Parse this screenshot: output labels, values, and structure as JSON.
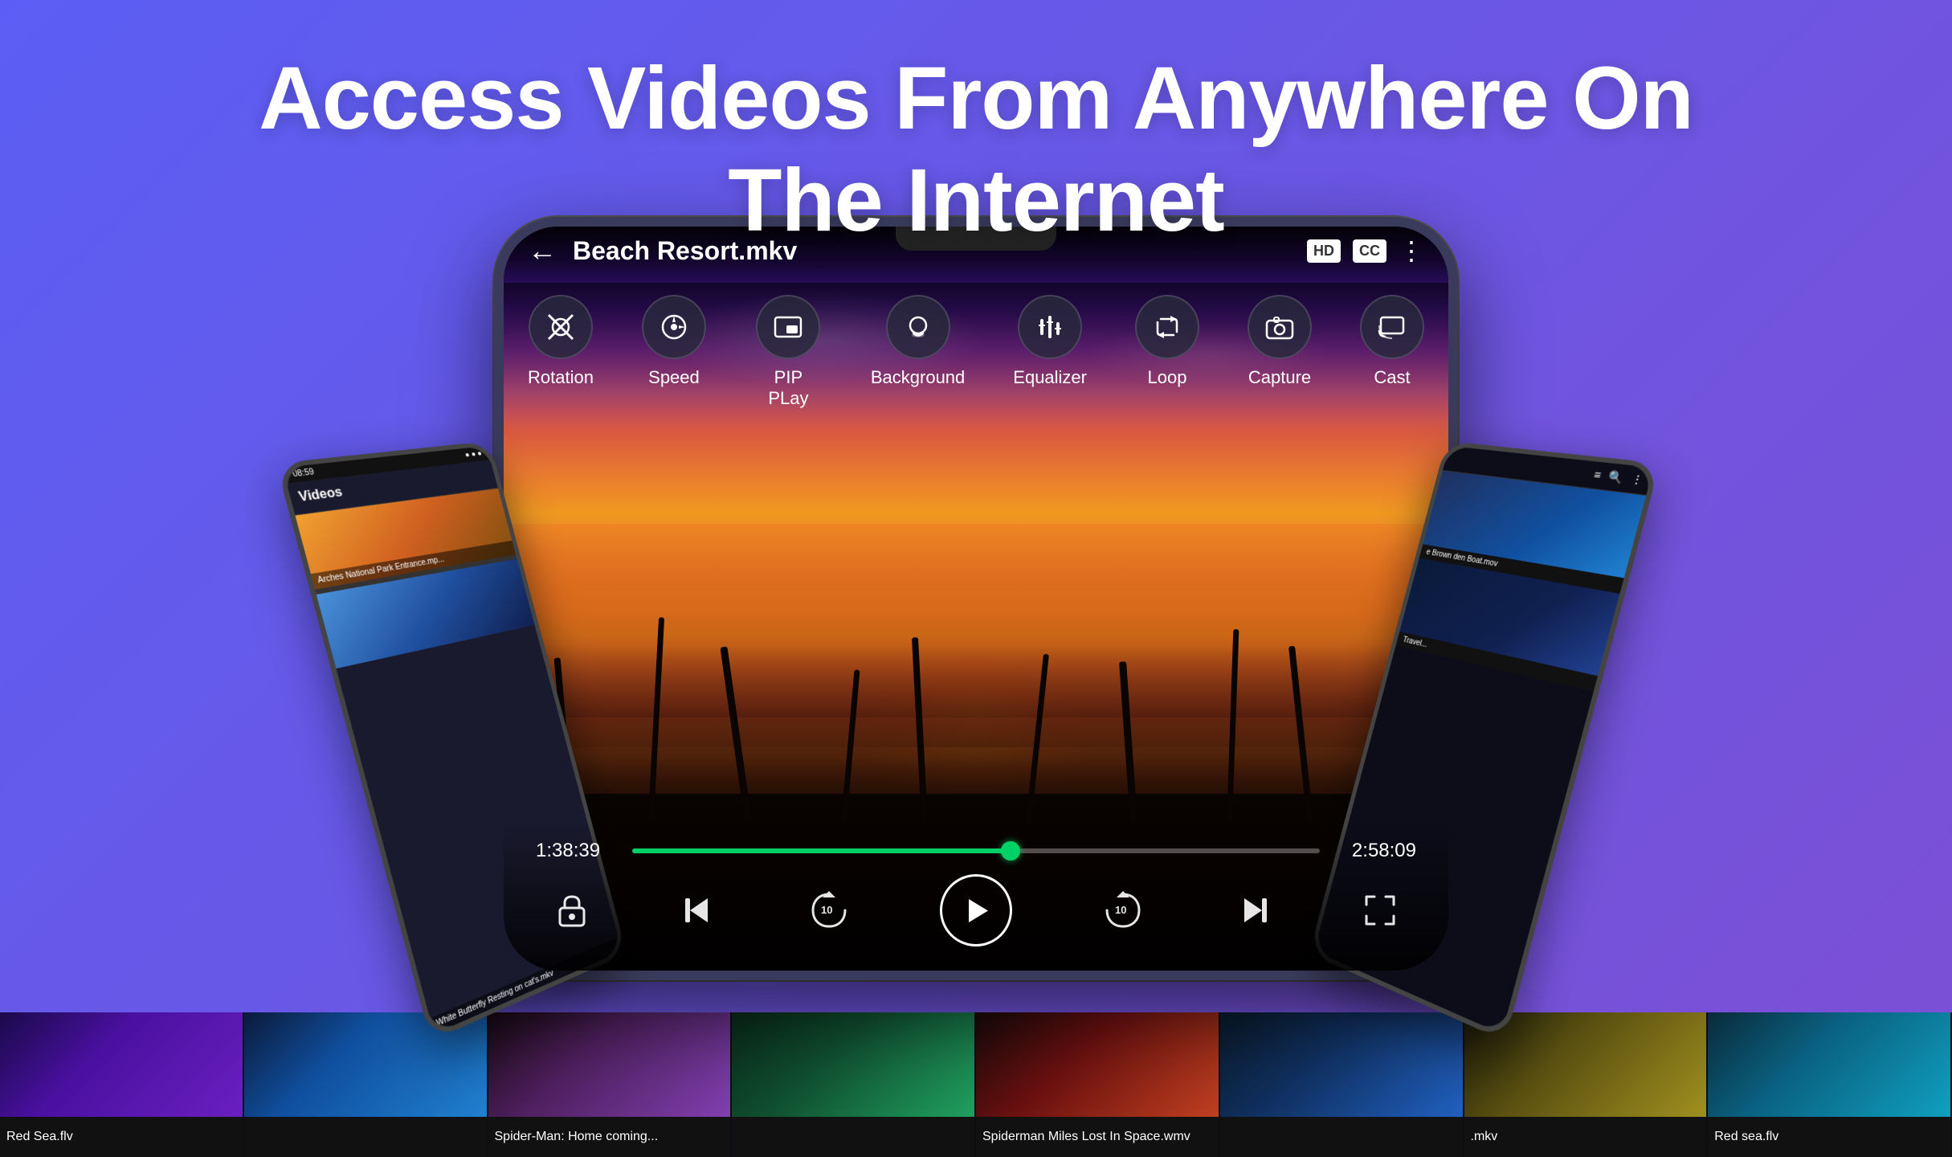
{
  "header": {
    "title_line1": "Access Videos From Anywhere On",
    "title_line2": "The Internet"
  },
  "player": {
    "video_title": "Beach Resort.mkv",
    "current_time": "1:38:39",
    "total_time": "2:58:09",
    "progress_pct": 55,
    "hd_badge": "HD",
    "cc_badge": "CC",
    "features": [
      {
        "icon": "↻⊗",
        "label": "Rotation",
        "unicode": "⊘"
      },
      {
        "icon": "◈",
        "label": "Speed",
        "unicode": "✦"
      },
      {
        "icon": "⬜",
        "label": "PIP PLay",
        "unicode": "▣"
      },
      {
        "icon": "🎧",
        "label": "Background",
        "unicode": "🎧"
      },
      {
        "icon": "⚙",
        "label": "Equalizer",
        "unicode": "≡"
      },
      {
        "icon": "↻",
        "label": "Loop",
        "unicode": "↻"
      },
      {
        "icon": "📷",
        "label": "Capture",
        "unicode": "⊙"
      },
      {
        "icon": "📺",
        "label": "Cast",
        "unicode": "⊡"
      }
    ]
  },
  "filmstrip": [
    {
      "title": "Red Sea.flv",
      "color": "ft1"
    },
    {
      "title": "",
      "color": "ft2"
    },
    {
      "title": "Spider-Man: Home coming...",
      "color": "ft3"
    },
    {
      "title": "",
      "color": "ft4"
    },
    {
      "title": "Spiderman Miles Lost In Space.wmv",
      "color": "ft5"
    },
    {
      "title": "",
      "color": "ft6"
    },
    {
      "title": ".mkv",
      "color": "ft7"
    },
    {
      "title": "Red sea.flv",
      "color": "ft8"
    }
  ],
  "left_phone": {
    "statusbar": "08:59",
    "header": "Videos",
    "items": [
      "Arches National Park Entrance.mp...",
      "White Butterfly Resting on cat's.mkv"
    ]
  },
  "right_phone": {
    "items": [
      "e Brown den Boat.mov",
      "Travel..."
    ]
  }
}
